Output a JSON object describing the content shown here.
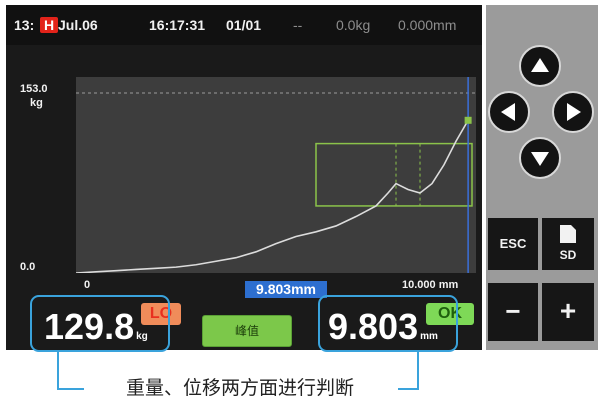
{
  "statusbar": {
    "channel": "13:",
    "channel_flag": "H",
    "date": "Jul.06",
    "time": "16:17:31",
    "counter": "01/01",
    "dash": "--",
    "load_readout": "0.0kg",
    "disp_readout": "0.000mm"
  },
  "graph": {
    "y_max_label": "153.0",
    "y_unit_label": "kg",
    "y_min_label": "0.0",
    "x_min_label": "0",
    "x_max_label": "10.000 mm",
    "cursor_readout": "9.803mm"
  },
  "chart_data": {
    "type": "line",
    "xlim": [
      0,
      10.0
    ],
    "ylim": [
      0,
      153.0
    ],
    "x": [
      0,
      0.5,
      1.0,
      1.5,
      2.0,
      2.5,
      3.0,
      3.5,
      4.0,
      4.5,
      5.0,
      5.5,
      6.0,
      6.5,
      7.0,
      7.5,
      7.8,
      8.0,
      8.3,
      8.6,
      8.9,
      9.2,
      9.5,
      9.803
    ],
    "y": [
      0,
      1,
      2,
      3,
      4,
      5,
      7,
      10,
      13,
      18,
      25,
      31,
      35,
      40,
      48,
      57,
      68,
      76,
      71,
      68,
      76,
      92,
      112,
      129.8
    ],
    "peak": {
      "x": 9.803,
      "y": 129.8
    },
    "cursor_x": 9.803,
    "window": {
      "x_min": 6.0,
      "x_max": 9.9,
      "y_min": 57,
      "y_max": 110
    },
    "grid": false
  },
  "results": {
    "load_value": "129.8",
    "load_unit": "kg",
    "load_judgement": "LO",
    "disp_value": "9.803",
    "disp_unit": "mm",
    "disp_judgement": "OK",
    "peak_button_label": "峰值"
  },
  "panel": {
    "esc_label": "ESC",
    "sd_label": "SD",
    "minus_label": "−",
    "plus_label": "+"
  },
  "caption": {
    "text": "重量、位移两方面进行判断"
  },
  "colors": {
    "curve": "#dcdcdc",
    "cursor": "#3a6fd8",
    "window": "#8bc34a",
    "lo": "#f08c5a",
    "ok": "#7ed957",
    "callout": "#3aa3dc"
  }
}
